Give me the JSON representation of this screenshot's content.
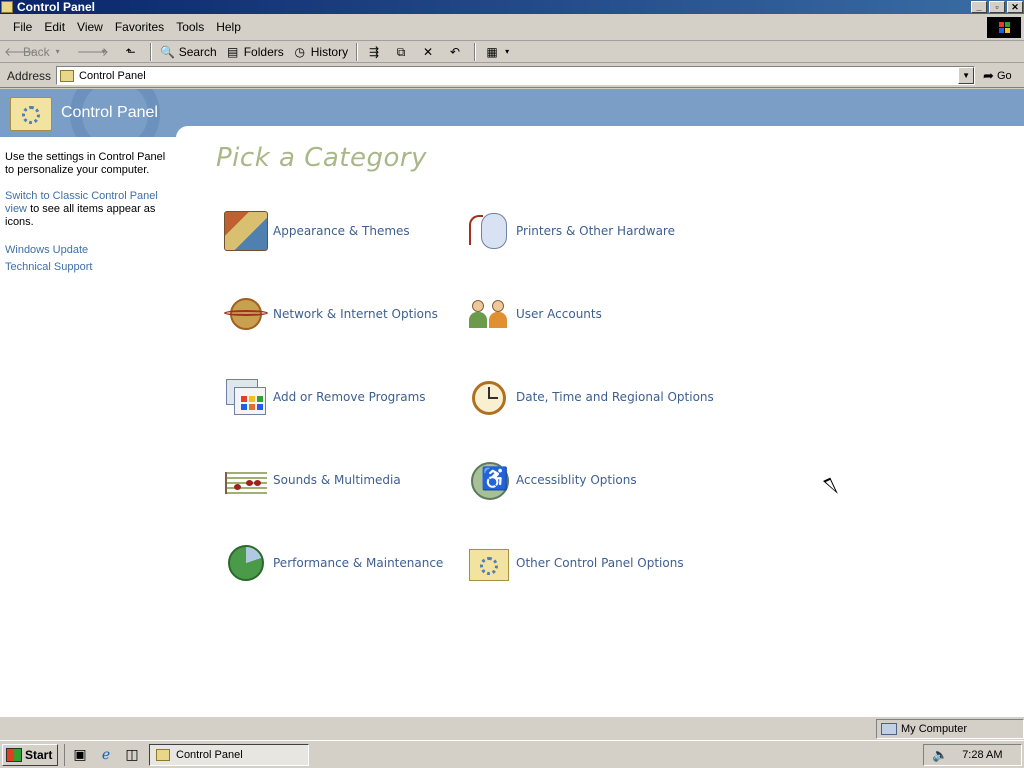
{
  "window": {
    "title": "Control Panel"
  },
  "menu": [
    "File",
    "Edit",
    "View",
    "Favorites",
    "Tools",
    "Help"
  ],
  "toolbar": {
    "back": "Back",
    "search": "Search",
    "folders": "Folders",
    "history": "History"
  },
  "address": {
    "label": "Address",
    "value": "Control Panel",
    "go": "Go"
  },
  "header": {
    "title": "Control Panel"
  },
  "sidebar": {
    "intro": "Use the settings in Control Panel to personalize your computer.",
    "switch_link": "Switch to Classic Control Panel view",
    "switch_rest": " to see all items appear as icons.",
    "links": [
      "Windows Update",
      "Technical Support"
    ]
  },
  "main": {
    "heading": "Pick a Category",
    "categories": [
      {
        "label": "Appearance & Themes",
        "icon": "appearance-icon"
      },
      {
        "label": "Printers & Other Hardware",
        "icon": "mouse-printer-icon"
      },
      {
        "label": "Network & Internet Options",
        "icon": "globe-network-icon"
      },
      {
        "label": "User Accounts",
        "icon": "users-icon"
      },
      {
        "label": "Add or Remove Programs",
        "icon": "programs-icon"
      },
      {
        "label": "Date, Time and Regional Options",
        "icon": "clock-icon"
      },
      {
        "label": "Sounds & Multimedia",
        "icon": "music-staff-icon"
      },
      {
        "label": "Accessiblity Options",
        "icon": "wheelchair-icon"
      },
      {
        "label": "Performance & Maintenance",
        "icon": "pie-chart-icon"
      },
      {
        "label": "Other Control Panel Options",
        "icon": "folder-gear-icon"
      }
    ]
  },
  "status": {
    "zone": "My Computer"
  },
  "taskbar": {
    "start": "Start",
    "task": "Control Panel",
    "clock": "7:28 AM"
  },
  "colors": {
    "titlebar": "#0a246a",
    "header": "#7a9ec6",
    "link": "#3d5f8f",
    "heading": "#a9b889"
  }
}
